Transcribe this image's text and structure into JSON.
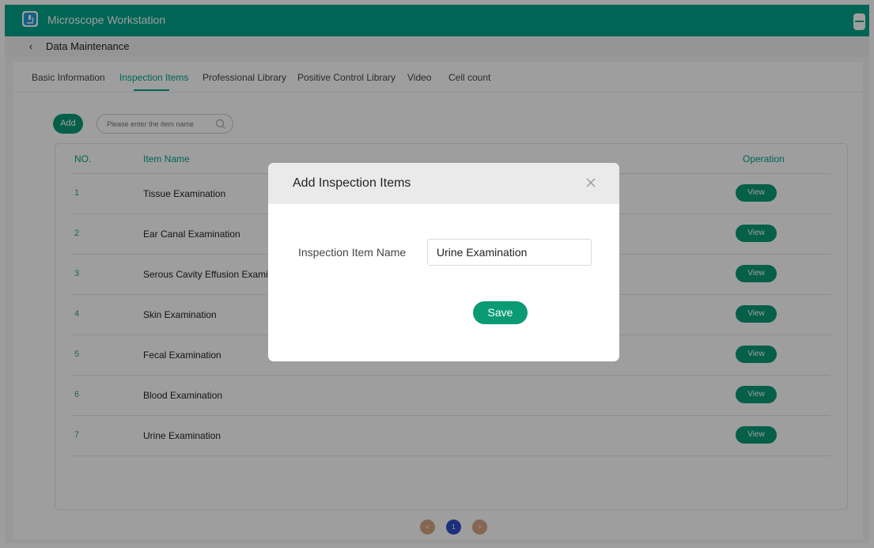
{
  "window": {
    "title": "Microscope Workstation",
    "app_icon": "microscope-icon",
    "minimize_icon": "minimize-icon"
  },
  "breadcrumb": {
    "back_icon": "chevron-left-icon",
    "back_glyph": "‹",
    "title": "Data Maintenance"
  },
  "tabs": [
    {
      "label": "Basic Information",
      "active": false
    },
    {
      "label": "Inspection Items",
      "active": true
    },
    {
      "label": "Professional Library",
      "active": false
    },
    {
      "label": "Positive Control Library",
      "active": false
    },
    {
      "label": "Video",
      "active": false
    },
    {
      "label": "Cell count",
      "active": false
    }
  ],
  "toolbar": {
    "add_label": "Add",
    "search_placeholder": "Please enter the item name",
    "search_value": "",
    "search_icon": "search-icon"
  },
  "table": {
    "columns": [
      "NO.",
      "Item Name",
      "Operation"
    ],
    "rows": [
      {
        "no": "1",
        "name": "Tissue Examination",
        "action": "View"
      },
      {
        "no": "2",
        "name": "Ear Canal Examination",
        "action": "View"
      },
      {
        "no": "3",
        "name": "Serous Cavity Effusion Examinati",
        "action": "View"
      },
      {
        "no": "4",
        "name": "Skin Examination",
        "action": "View"
      },
      {
        "no": "5",
        "name": "Fecal Examination",
        "action": "View"
      },
      {
        "no": "6",
        "name": "Blood Examination",
        "action": "View"
      },
      {
        "no": "7",
        "name": "Urine Examination",
        "action": "View"
      }
    ]
  },
  "pagination": {
    "prev": "<",
    "current_page": "1",
    "next": ">"
  },
  "dialog": {
    "title": "Add Inspection Items",
    "close_icon": "close-icon",
    "field_label": "Inspection Item Name",
    "field_value": "Urine Examination",
    "save_label": "Save"
  },
  "colors": {
    "accent": "#00a488",
    "button_green": "#0a9a74",
    "page_active": "#2c4ec9",
    "page_inactive": "#d9a585"
  }
}
